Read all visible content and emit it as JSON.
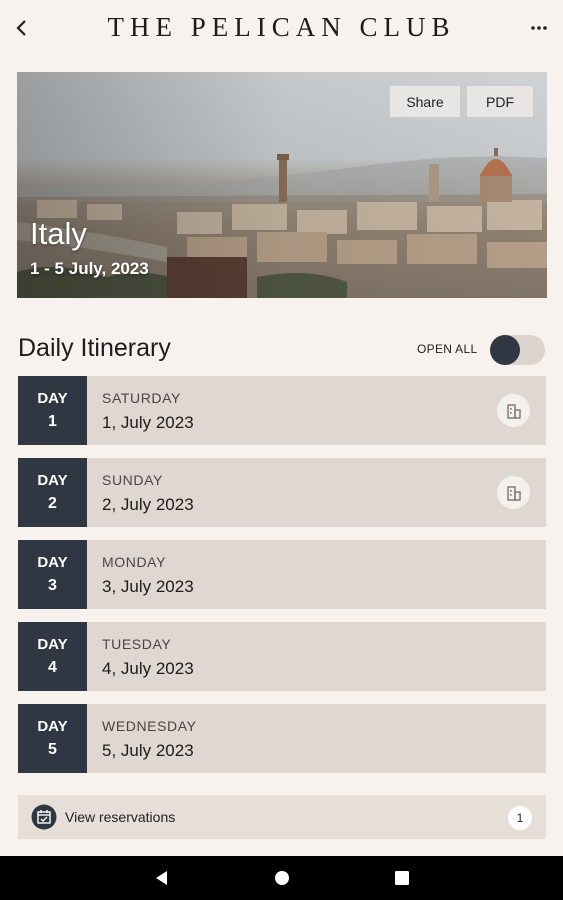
{
  "header": {
    "title": "THE PELICAN CLUB",
    "back_icon": "chevron-left-icon",
    "menu_icon": "more-horizontal-icon"
  },
  "hero": {
    "destination": "Italy",
    "dates": "1 - 5 July, 2023",
    "share_label": "Share",
    "pdf_label": "PDF"
  },
  "itinerary": {
    "title": "Daily Itinerary",
    "open_all_label": "OPEN ALL",
    "open_all_on": false,
    "days": [
      {
        "label": "DAY",
        "number": "1",
        "weekday": "SATURDAY",
        "date": "1, July 2023",
        "has_hotel": true
      },
      {
        "label": "DAY",
        "number": "2",
        "weekday": "SUNDAY",
        "date": "2, July 2023",
        "has_hotel": true
      },
      {
        "label": "DAY",
        "number": "3",
        "weekday": "MONDAY",
        "date": "3, July 2023",
        "has_hotel": false
      },
      {
        "label": "DAY",
        "number": "4",
        "weekday": "TUESDAY",
        "date": "4, July 2023",
        "has_hotel": false
      },
      {
        "label": "DAY",
        "number": "5",
        "weekday": "WEDNESDAY",
        "date": "5, July 2023",
        "has_hotel": false
      }
    ]
  },
  "reservations": {
    "label": "View reservations",
    "count": "1",
    "icon": "calendar-check-icon"
  },
  "colors": {
    "background": "#f7f2ee",
    "badge": "#2f3742",
    "row": "#e0d8d0"
  }
}
